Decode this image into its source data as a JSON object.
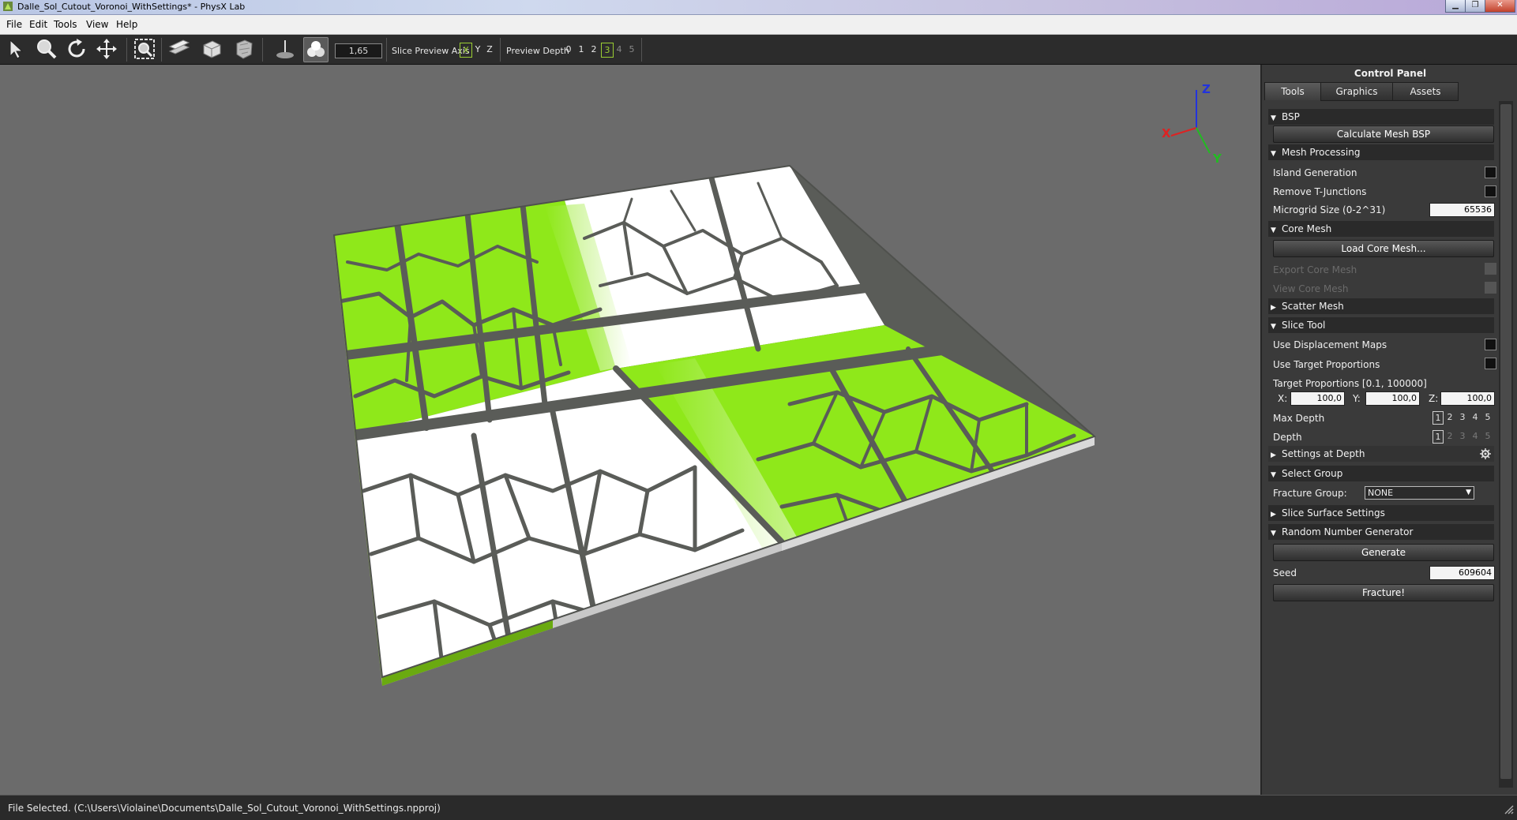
{
  "window": {
    "title": "Dalle_Sol_Cutout_Voronoi_WithSettings* - PhysX Lab",
    "buttons": [
      "minimize",
      "maximize",
      "close"
    ]
  },
  "menubar": {
    "items": [
      "File",
      "Edit",
      "Tools",
      "View",
      "Help"
    ]
  },
  "toolbar": {
    "tools": [
      "select-arrow-icon",
      "zoom-icon",
      "rotate-icon",
      "move-icon",
      "zoom-extents-icon",
      "slice-icon",
      "box-icon",
      "chunk-icon",
      "plane-icon",
      "spheres-icon"
    ],
    "scale_value": "1,65",
    "slice_preview_label": "Slice Preview Axis",
    "axes": [
      "X",
      "Y",
      "Z"
    ],
    "selected_axis": "X",
    "preview_depth_label": "Preview Depth",
    "depths": [
      "0",
      "1",
      "2",
      "3",
      "4",
      "5"
    ],
    "selected_depth": "3",
    "accent": "#9acd32"
  },
  "viewport": {
    "axis_labels": {
      "x": "X",
      "y": "Y",
      "z": "Z"
    },
    "colors": {
      "background": "#6b6b6b",
      "green": "#8fe81a",
      "white": "#ffffff",
      "crack": "#5a5c58"
    }
  },
  "panel": {
    "title": "Control Panel",
    "tabs": [
      "Tools",
      "Graphics",
      "Assets"
    ],
    "active_tab": "Tools",
    "bsp": {
      "header": "BSP",
      "calc_button": "Calculate Mesh BSP"
    },
    "mesh_processing": {
      "header": "Mesh Processing",
      "island_generation": "Island Generation",
      "remove_t_junctions": "Remove T-Junctions",
      "microgrid_label": "Microgrid Size (0-2^31)",
      "microgrid_value": "65536"
    },
    "core_mesh": {
      "header": "Core Mesh",
      "load_button": "Load Core Mesh...",
      "export": "Export Core Mesh",
      "view": "View Core Mesh"
    },
    "scatter_mesh": {
      "header": "Scatter Mesh"
    },
    "slice_tool": {
      "header": "Slice Tool",
      "use_displacement": "Use Displacement Maps",
      "use_target": "Use Target Proportions",
      "target_label": "Target Proportions [0.1, 100000]",
      "x_label": "X:",
      "x_value": "100,0",
      "y_label": "Y:",
      "y_value": "100,0",
      "z_label": "Z:",
      "z_value": "100,0",
      "max_depth_label": "Max Depth",
      "depth_label": "Depth",
      "depth_options": [
        "1",
        "2",
        "3",
        "4",
        "5"
      ],
      "max_depth_selected": "1",
      "depth_selected": "1",
      "settings_at_depth": "Settings at Depth"
    },
    "select_group": {
      "header": "Select Group",
      "fracture_group_label": "Fracture Group:",
      "fracture_group_value": "NONE"
    },
    "slice_surface": {
      "header": "Slice Surface Settings"
    },
    "rng": {
      "header": "Random Number Generator",
      "generate_button": "Generate",
      "seed_label": "Seed",
      "seed_value": "609604",
      "fracture_button": "Fracture!"
    }
  },
  "status": {
    "text": "File Selected. (C:\\Users\\Violaine\\Documents\\Dalle_Sol_Cutout_Voronoi_WithSettings.npproj)"
  }
}
